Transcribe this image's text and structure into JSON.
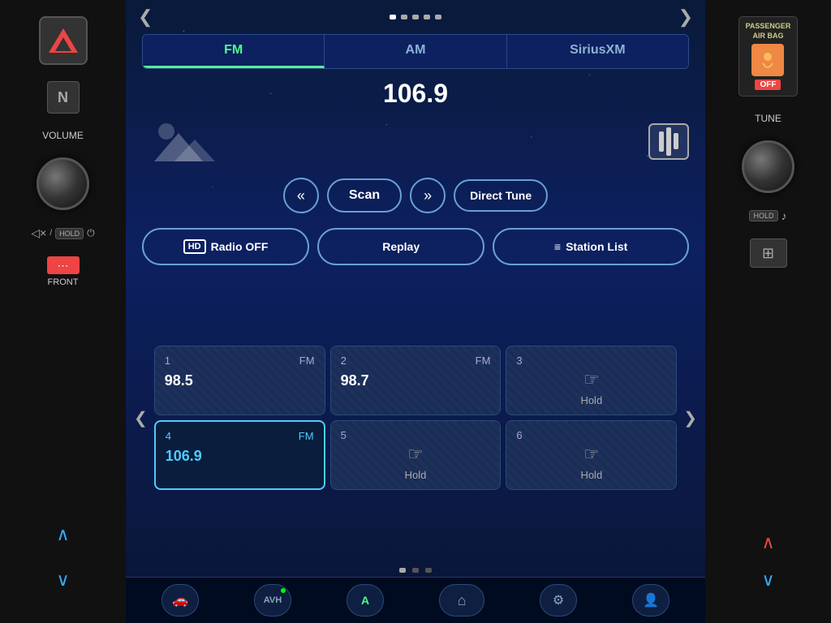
{
  "left_panel": {
    "volume_label": "VOLUME",
    "mute_symbol": "◁×",
    "hold_label": "HOLD",
    "power_symbol": "⏻",
    "front_label": "FRONT",
    "arrow_up": "❮",
    "arrow_down": "❯"
  },
  "screen": {
    "top_nav": {
      "left_arrow": "❮",
      "right_arrow": "❯"
    },
    "tabs": [
      {
        "id": "fm",
        "label": "FM",
        "active": true
      },
      {
        "id": "am",
        "label": "AM",
        "active": false
      },
      {
        "id": "siriusxm",
        "label": "SiriusXM",
        "active": false
      }
    ],
    "frequency": "106.9",
    "equalizer_label": "EQ",
    "controls": {
      "prev_label": "⏮",
      "scan_label": "Scan",
      "next_label": "⏭",
      "direct_tune_label": "Direct Tune"
    },
    "secondary": {
      "hd_radio_label": "Radio OFF",
      "hd_badge": "HD",
      "replay_label": "Replay",
      "station_list_label": "Station List",
      "station_list_icon": "≡"
    },
    "presets": [
      {
        "num": "1",
        "band": "FM",
        "freq": "98.5",
        "hold": false,
        "active": false
      },
      {
        "num": "2",
        "band": "FM",
        "freq": "98.7",
        "hold": false,
        "active": false
      },
      {
        "num": "3",
        "band": "",
        "freq": "",
        "hold": true,
        "active": false
      },
      {
        "num": "4",
        "band": "FM",
        "freq": "106.9",
        "hold": false,
        "active": true
      },
      {
        "num": "5",
        "band": "",
        "freq": "",
        "hold": true,
        "active": false
      },
      {
        "num": "6",
        "band": "",
        "freq": "",
        "hold": true,
        "active": false
      }
    ],
    "hold_label": "Hold",
    "page_dots": [
      {
        "active": true
      },
      {
        "active": false
      },
      {
        "active": false
      }
    ],
    "bottom_bar": {
      "car_icon": "🚗",
      "avh_label": "AVH",
      "a_label": "A",
      "home_label": "⌂",
      "settings_label": "⚙",
      "user_label": "👤"
    }
  },
  "right_panel": {
    "airbag_text": "PASSENGER\nAIR BAG",
    "off_label": "OFF",
    "tune_label": "TUNE",
    "hold_label": "HOLD",
    "music_symbol": "♪",
    "arrow_up": "❮",
    "arrow_down": "❯"
  }
}
